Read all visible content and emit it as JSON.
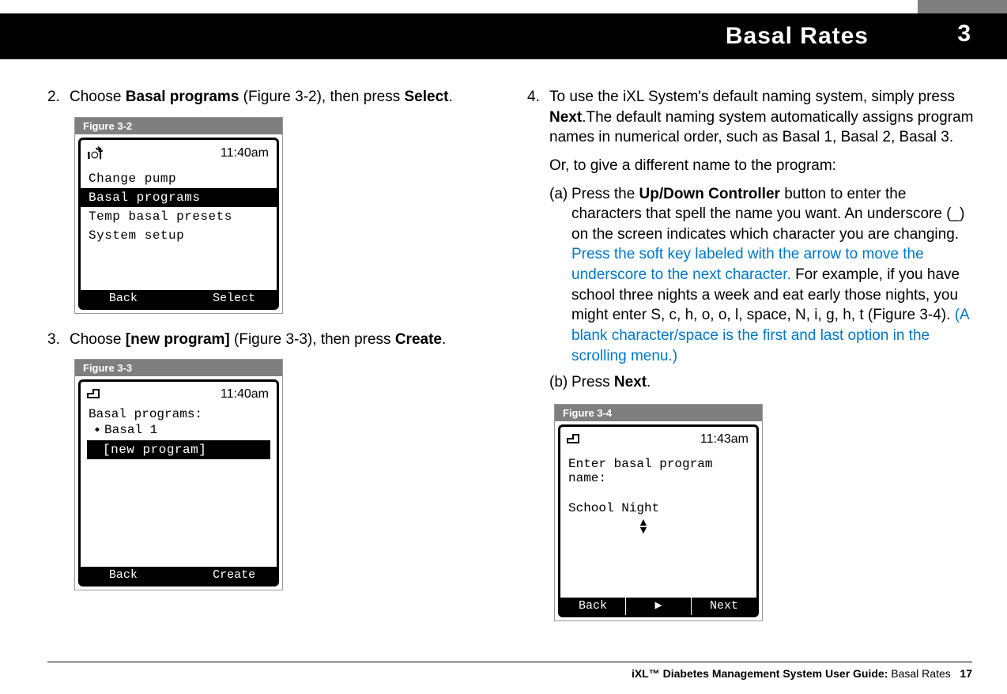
{
  "header": {
    "title": "Basal Rates",
    "chapter": "3"
  },
  "col1": {
    "step2": {
      "num": "2.",
      "pre": "Choose ",
      "bold1": "Basal programs",
      "mid": " (Figure 3-2), then press ",
      "bold2": "Select",
      "post": "."
    },
    "fig32": {
      "label": "Figure 3-2",
      "icon": "↑",
      "icon_small": "I",
      "time": "11:40am",
      "items": [
        "Change pump",
        "Basal programs",
        "Temp basal presets",
        "System setup"
      ],
      "selected_index": 1,
      "left": "Back",
      "right": "Select"
    },
    "step3": {
      "num": "3.",
      "pre": "Choose ",
      "bold1": "[new program]",
      "mid": " (Figure 3-3), then press ",
      "bold2": "Create",
      "post": "."
    },
    "fig33": {
      "label": "Figure 3-3",
      "time": "11:40am",
      "heading": "Basal programs:",
      "item1": "Basal 1",
      "sel_item": "[new program]",
      "left": "Back",
      "right": "Create"
    }
  },
  "col2": {
    "step4": {
      "num": "4.",
      "line1_pre": "To use the iXL System's default naming system, simply press ",
      "line1_bold": "Next",
      "line1_post": ".The default naming system automatically assigns program names in numerical order, such as Basal 1, Basal 2, Basal 3.",
      "line2": "Or, to give a different name to the program:",
      "sub_a": {
        "lbl": "(a)",
        "pre": "Press the ",
        "bold": "Up/Down Controller",
        "mid": " button to enter the characters that spell the name you want. An underscore (_) on the screen indicates which character you are changing. ",
        "blue1": "Press the soft key labeled with the arrow to move the underscore to the next character. ",
        "post": "For example, if you have school three nights a week and eat early those nights, you might enter S, c, h, o, o, l, space, N, i, g, h, t (Figure 3-4). ",
        "blue2": "(A blank character/space is the first and last option in the scrolling menu.)"
      },
      "sub_b": {
        "lbl": "(b)",
        "pre": "Press ",
        "bold": "Next",
        "post": "."
      }
    },
    "fig34": {
      "label": "Figure 3-4",
      "time": "11:43am",
      "prompt": "Enter basal program name:",
      "entered": "School Night",
      "left": "Back",
      "mid": "▶",
      "right": "Next"
    }
  },
  "footer": {
    "bold": "iXL™ Diabetes Management System User Guide:",
    "plain": " Basal Rates",
    "page": "17"
  }
}
